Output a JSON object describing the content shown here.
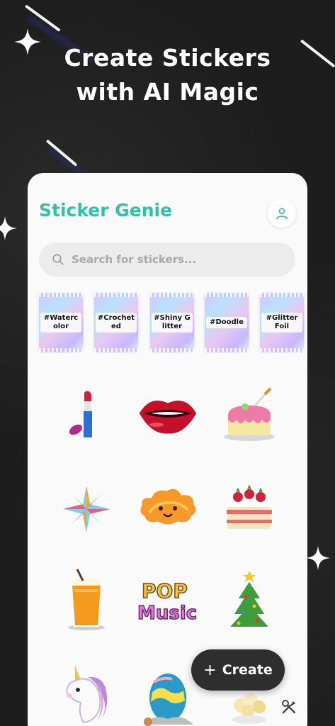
{
  "headline": {
    "line1": "Create Stickers",
    "line2": "with AI Magic"
  },
  "app": {
    "title": "Sticker Genie"
  },
  "search": {
    "placeholder": "Search for stickers..."
  },
  "packs": [
    {
      "label": "#Watercolor"
    },
    {
      "label": "#Crocheted"
    },
    {
      "label": "#Shiny Glitter"
    },
    {
      "label": "#Doodle"
    },
    {
      "label": "#Glitter Foil"
    }
  ],
  "stickers": [
    "lipstick-sticker",
    "lips-sticker",
    "cake-sticker",
    "star-sticker",
    "cloud-sticker",
    "strawberry-cake-sticker",
    "orange-drink-sticker",
    "pop-music-sticker",
    "christmas-tree-sticker",
    "unicorn-sticker",
    "egg-sticker",
    "popcorn-sticker"
  ],
  "pop_music_text": {
    "line1": "POP",
    "line2": "Music"
  },
  "create_button": {
    "icon": "+",
    "label": "Create"
  },
  "colors": {
    "accent": "#33c0a6",
    "card": "#fafafa",
    "background": "#1d1d1d",
    "button": "#2e2e2e"
  }
}
